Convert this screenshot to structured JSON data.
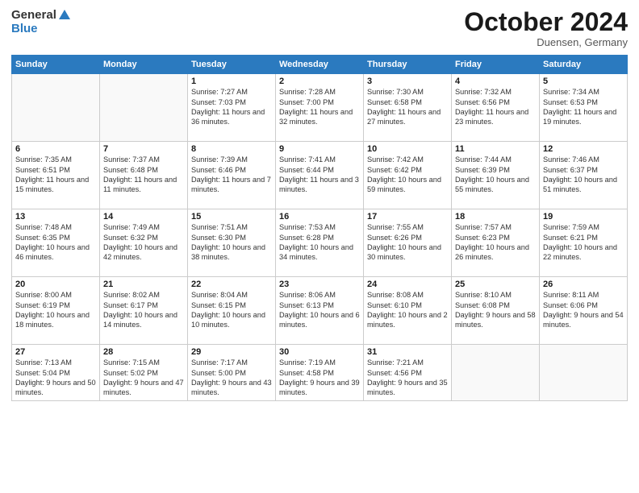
{
  "logo": {
    "line1": "General",
    "line2": "Blue"
  },
  "title": "October 2024",
  "subtitle": "Duensen, Germany",
  "days_header": [
    "Sunday",
    "Monday",
    "Tuesday",
    "Wednesday",
    "Thursday",
    "Friday",
    "Saturday"
  ],
  "weeks": [
    [
      {
        "day": "",
        "info": ""
      },
      {
        "day": "",
        "info": ""
      },
      {
        "day": "1",
        "info": "Sunrise: 7:27 AM\nSunset: 7:03 PM\nDaylight: 11 hours and 36 minutes."
      },
      {
        "day": "2",
        "info": "Sunrise: 7:28 AM\nSunset: 7:00 PM\nDaylight: 11 hours and 32 minutes."
      },
      {
        "day": "3",
        "info": "Sunrise: 7:30 AM\nSunset: 6:58 PM\nDaylight: 11 hours and 27 minutes."
      },
      {
        "day": "4",
        "info": "Sunrise: 7:32 AM\nSunset: 6:56 PM\nDaylight: 11 hours and 23 minutes."
      },
      {
        "day": "5",
        "info": "Sunrise: 7:34 AM\nSunset: 6:53 PM\nDaylight: 11 hours and 19 minutes."
      }
    ],
    [
      {
        "day": "6",
        "info": "Sunrise: 7:35 AM\nSunset: 6:51 PM\nDaylight: 11 hours and 15 minutes."
      },
      {
        "day": "7",
        "info": "Sunrise: 7:37 AM\nSunset: 6:48 PM\nDaylight: 11 hours and 11 minutes."
      },
      {
        "day": "8",
        "info": "Sunrise: 7:39 AM\nSunset: 6:46 PM\nDaylight: 11 hours and 7 minutes."
      },
      {
        "day": "9",
        "info": "Sunrise: 7:41 AM\nSunset: 6:44 PM\nDaylight: 11 hours and 3 minutes."
      },
      {
        "day": "10",
        "info": "Sunrise: 7:42 AM\nSunset: 6:42 PM\nDaylight: 10 hours and 59 minutes."
      },
      {
        "day": "11",
        "info": "Sunrise: 7:44 AM\nSunset: 6:39 PM\nDaylight: 10 hours and 55 minutes."
      },
      {
        "day": "12",
        "info": "Sunrise: 7:46 AM\nSunset: 6:37 PM\nDaylight: 10 hours and 51 minutes."
      }
    ],
    [
      {
        "day": "13",
        "info": "Sunrise: 7:48 AM\nSunset: 6:35 PM\nDaylight: 10 hours and 46 minutes."
      },
      {
        "day": "14",
        "info": "Sunrise: 7:49 AM\nSunset: 6:32 PM\nDaylight: 10 hours and 42 minutes."
      },
      {
        "day": "15",
        "info": "Sunrise: 7:51 AM\nSunset: 6:30 PM\nDaylight: 10 hours and 38 minutes."
      },
      {
        "day": "16",
        "info": "Sunrise: 7:53 AM\nSunset: 6:28 PM\nDaylight: 10 hours and 34 minutes."
      },
      {
        "day": "17",
        "info": "Sunrise: 7:55 AM\nSunset: 6:26 PM\nDaylight: 10 hours and 30 minutes."
      },
      {
        "day": "18",
        "info": "Sunrise: 7:57 AM\nSunset: 6:23 PM\nDaylight: 10 hours and 26 minutes."
      },
      {
        "day": "19",
        "info": "Sunrise: 7:59 AM\nSunset: 6:21 PM\nDaylight: 10 hours and 22 minutes."
      }
    ],
    [
      {
        "day": "20",
        "info": "Sunrise: 8:00 AM\nSunset: 6:19 PM\nDaylight: 10 hours and 18 minutes."
      },
      {
        "day": "21",
        "info": "Sunrise: 8:02 AM\nSunset: 6:17 PM\nDaylight: 10 hours and 14 minutes."
      },
      {
        "day": "22",
        "info": "Sunrise: 8:04 AM\nSunset: 6:15 PM\nDaylight: 10 hours and 10 minutes."
      },
      {
        "day": "23",
        "info": "Sunrise: 8:06 AM\nSunset: 6:13 PM\nDaylight: 10 hours and 6 minutes."
      },
      {
        "day": "24",
        "info": "Sunrise: 8:08 AM\nSunset: 6:10 PM\nDaylight: 10 hours and 2 minutes."
      },
      {
        "day": "25",
        "info": "Sunrise: 8:10 AM\nSunset: 6:08 PM\nDaylight: 9 hours and 58 minutes."
      },
      {
        "day": "26",
        "info": "Sunrise: 8:11 AM\nSunset: 6:06 PM\nDaylight: 9 hours and 54 minutes."
      }
    ],
    [
      {
        "day": "27",
        "info": "Sunrise: 7:13 AM\nSunset: 5:04 PM\nDaylight: 9 hours and 50 minutes."
      },
      {
        "day": "28",
        "info": "Sunrise: 7:15 AM\nSunset: 5:02 PM\nDaylight: 9 hours and 47 minutes."
      },
      {
        "day": "29",
        "info": "Sunrise: 7:17 AM\nSunset: 5:00 PM\nDaylight: 9 hours and 43 minutes."
      },
      {
        "day": "30",
        "info": "Sunrise: 7:19 AM\nSunset: 4:58 PM\nDaylight: 9 hours and 39 minutes."
      },
      {
        "day": "31",
        "info": "Sunrise: 7:21 AM\nSunset: 4:56 PM\nDaylight: 9 hours and 35 minutes."
      },
      {
        "day": "",
        "info": ""
      },
      {
        "day": "",
        "info": ""
      }
    ]
  ]
}
